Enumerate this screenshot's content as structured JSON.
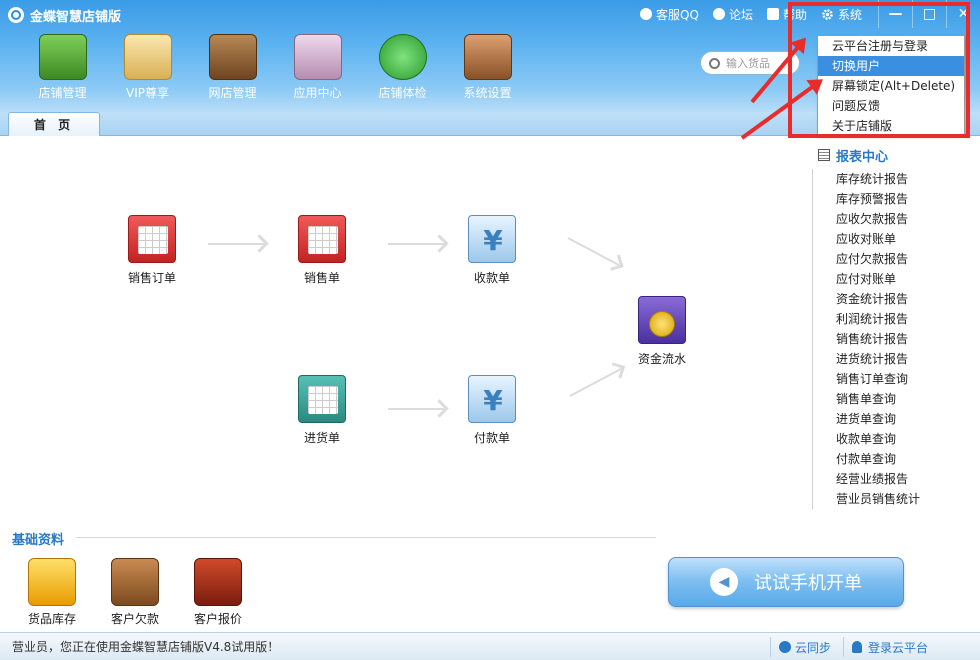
{
  "window": {
    "title": "金蝶智慧店铺版",
    "links": [
      {
        "label": "客服QQ",
        "icon": "bell-icon"
      },
      {
        "label": "论坛",
        "icon": "people-icon"
      },
      {
        "label": "帮助",
        "icon": "book-icon"
      }
    ],
    "system_label": "系统",
    "controls": {
      "minimize": "—",
      "maximize": "□",
      "close": "✕"
    }
  },
  "toolbar": {
    "items": [
      {
        "label": "店铺管理",
        "icon": "shop-icon",
        "color": "#4a9a2e"
      },
      {
        "label": "VIP尊享",
        "icon": "vip-card-icon",
        "color": "#e6c06b"
      },
      {
        "label": "网店管理",
        "icon": "cart-icon",
        "color": "#8b5a2b"
      },
      {
        "label": "应用中心",
        "icon": "app-center-icon",
        "color": "#c9a0c0"
      },
      {
        "label": "店铺体检",
        "icon": "home-check-icon",
        "color": "#3aa53a"
      },
      {
        "label": "系统设置",
        "icon": "settings-box-icon",
        "color": "#b07040"
      }
    ],
    "search_placeholder": "输入货品"
  },
  "tabs": {
    "home": "首 页"
  },
  "flow": {
    "sales_order": "销售订单",
    "sales_slip": "销售单",
    "receipt": "收款单",
    "cash_flow": "资金流水",
    "purchase_slip": "进货单",
    "payment": "付款单",
    "yen_symbol": "¥"
  },
  "report_center": {
    "title": "报表中心",
    "items": [
      "库存统计报告",
      "库存预警报告",
      "应收欠款报告",
      "应收对账单",
      "应付欠款报告",
      "应付对账单",
      "资金统计报告",
      "利润统计报告",
      "销售统计报告",
      "进货统计报告",
      "销售订单查询",
      "销售单查询",
      "进货单查询",
      "收款单查询",
      "付款单查询",
      "经营业绩报告",
      "营业员销售统计"
    ]
  },
  "basic_data": {
    "title": "基础资料",
    "items": [
      "货品库存",
      "客户欠款",
      "客户报价"
    ]
  },
  "mobile_button": "试试手机开单",
  "status": {
    "message": "营业员，您正在使用金蝶智慧店铺版V4.8试用版！",
    "sync": "云同步",
    "login": "登录云平台"
  },
  "system_menu": {
    "items": [
      "云平台注册与登录",
      "切换用户",
      "屏幕锁定(Alt+Delete)",
      "问题反馈",
      "关于店铺版"
    ],
    "highlight_index": 1
  },
  "colors": {
    "annotation_red": "#e82c2c",
    "accent_blue": "#2a78c8"
  }
}
